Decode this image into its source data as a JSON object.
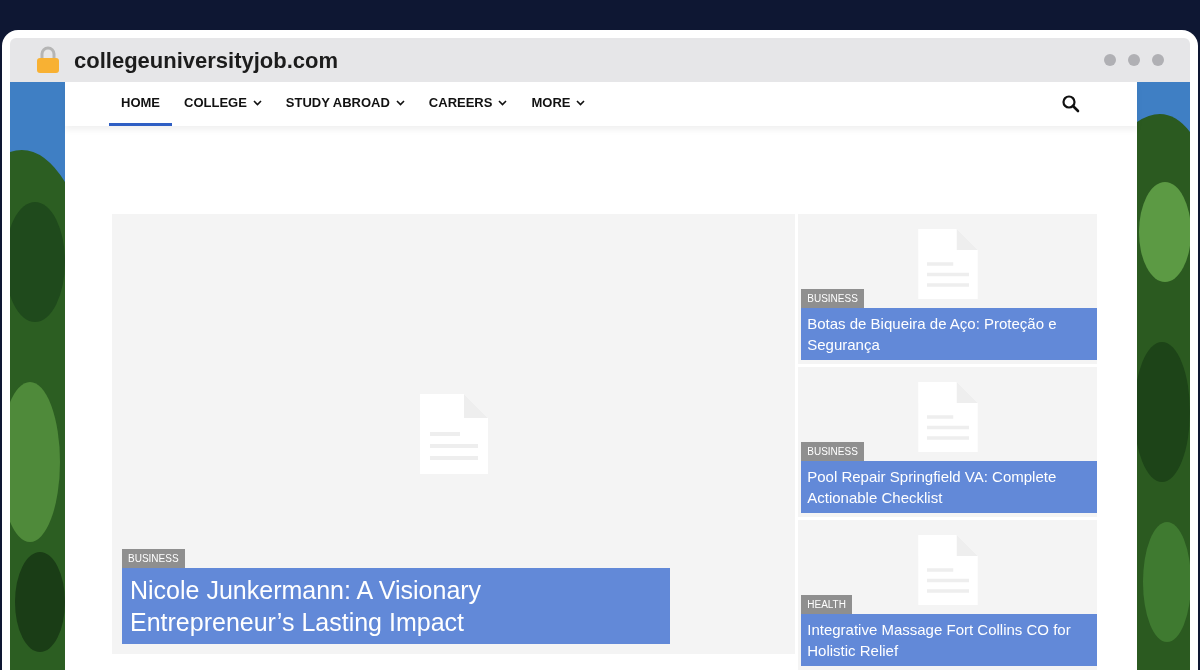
{
  "browser": {
    "address": "collegeuniversityjob.com"
  },
  "nav": {
    "items": [
      {
        "label": "HOME",
        "selected": true,
        "has_menu": false
      },
      {
        "label": "COLLEGE",
        "selected": false,
        "has_menu": true
      },
      {
        "label": "STUDY ABROAD",
        "selected": false,
        "has_menu": true
      },
      {
        "label": "CAREERS",
        "selected": false,
        "has_menu": true
      },
      {
        "label": "MORE",
        "selected": false,
        "has_menu": true
      }
    ]
  },
  "featured": {
    "category": "BUSINESS",
    "title": "Nicole Junkermann: A Visionary Entrepreneur’s Lasting Impact"
  },
  "side_posts": [
    {
      "category": "BUSINESS",
      "title": "Botas de Biqueira de Aço: Proteção e Segurança"
    },
    {
      "category": "BUSINESS",
      "title": "Pool Repair Springfield VA: Complete Actionable Checklist"
    },
    {
      "category": "HEALTH",
      "title": "Integrative Massage Fort Collins CO for Holistic Relief"
    }
  ]
}
